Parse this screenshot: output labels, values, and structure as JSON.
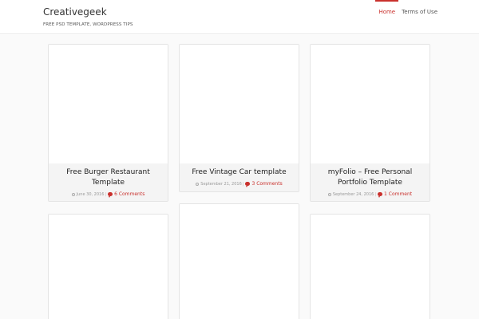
{
  "site": {
    "title": "Creativegeek",
    "description": "FREE PSD TEMPLATE, WORDPRESS TIPS"
  },
  "nav": {
    "items": [
      {
        "label": "Home",
        "active": true
      },
      {
        "label": "Terms of Use",
        "active": false
      }
    ]
  },
  "posts": [
    {
      "title": "Free Burger Restaurant Template",
      "date": "June 30, 2016",
      "comments": "6 Comments"
    },
    {
      "title": "Free Vintage Car template",
      "date": "September 21, 2016",
      "comments": "3 Comments"
    },
    {
      "title": "myFolio – Free Personal Portfolio Template",
      "date": "September 24, 2016",
      "comments": "1 Comment"
    }
  ],
  "colors": {
    "accent": "#c9302c",
    "info_background": "#f4f4f4",
    "page_background": "#fafafa"
  }
}
